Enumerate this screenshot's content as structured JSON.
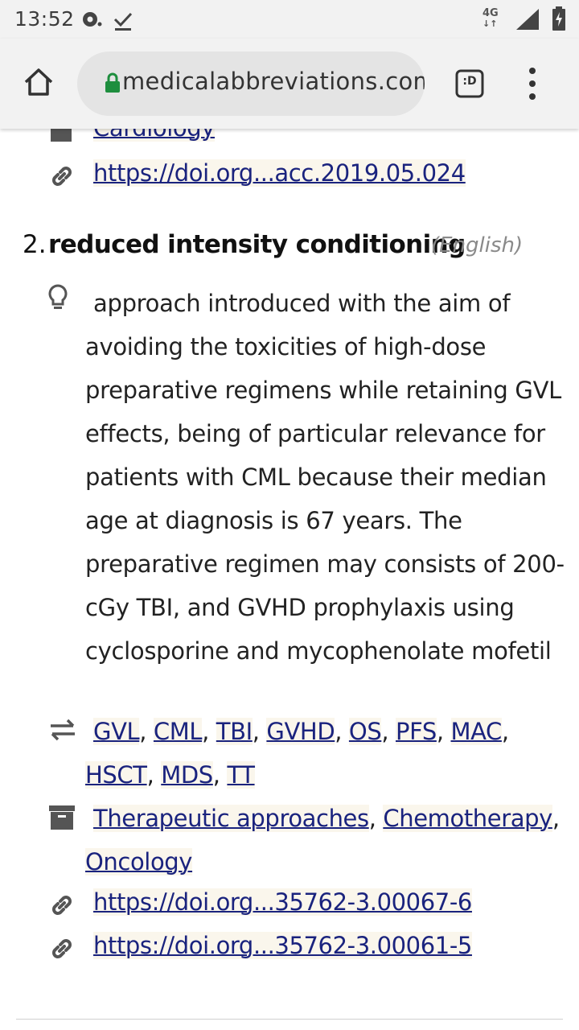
{
  "status_bar": {
    "time": "13:52",
    "network": "4G"
  },
  "browser": {
    "url": "medicalabbreviations.com",
    "tab_switcher_label": ":D"
  },
  "previous_entry": {
    "category_partial": "Cardiology",
    "doi_link": "https://doi.org...acc.2019.05.024"
  },
  "entry": {
    "number": "2.",
    "title": "reduced intensity conditioning",
    "language": "(English)",
    "definition": "approach introduced with the aim of avoiding the toxicities of high-dose preparative regimens while retaining GVL effects, being of particular relevance for patients with CML because their median age at diagnosis is 67 years. The preparative regimen may consists of 200-cGy TBI, and GVHD prophylaxis using cyclosporine and mycophenolate mofetil",
    "related": [
      "GVL",
      "CML",
      "TBI",
      "GVHD",
      "OS",
      "PFS",
      "MAC",
      "HSCT",
      "MDS",
      "TT"
    ],
    "categories": [
      "Therapeutic approaches",
      "Chemotherapy",
      "Oncology"
    ],
    "doi_links": [
      "https://doi.org...35762-3.00067-6",
      "https://doi.org...35762-3.00061-5"
    ]
  },
  "icons": {
    "status": [
      "sync-icon",
      "download-done-icon",
      "signal-icon",
      "battery-charging-icon"
    ],
    "toolbar": [
      "home-icon",
      "lock-icon",
      "tab-switcher-icon",
      "overflow-menu-icon"
    ],
    "entry": [
      "folder-icon",
      "link-icon",
      "lightbulb-icon",
      "swap-icon",
      "archive-icon"
    ]
  },
  "colors": {
    "link": "#1a237e",
    "link_background": "#faf6ec",
    "lock": "#1e8e3e",
    "toolbar": "#f2f2f2"
  }
}
